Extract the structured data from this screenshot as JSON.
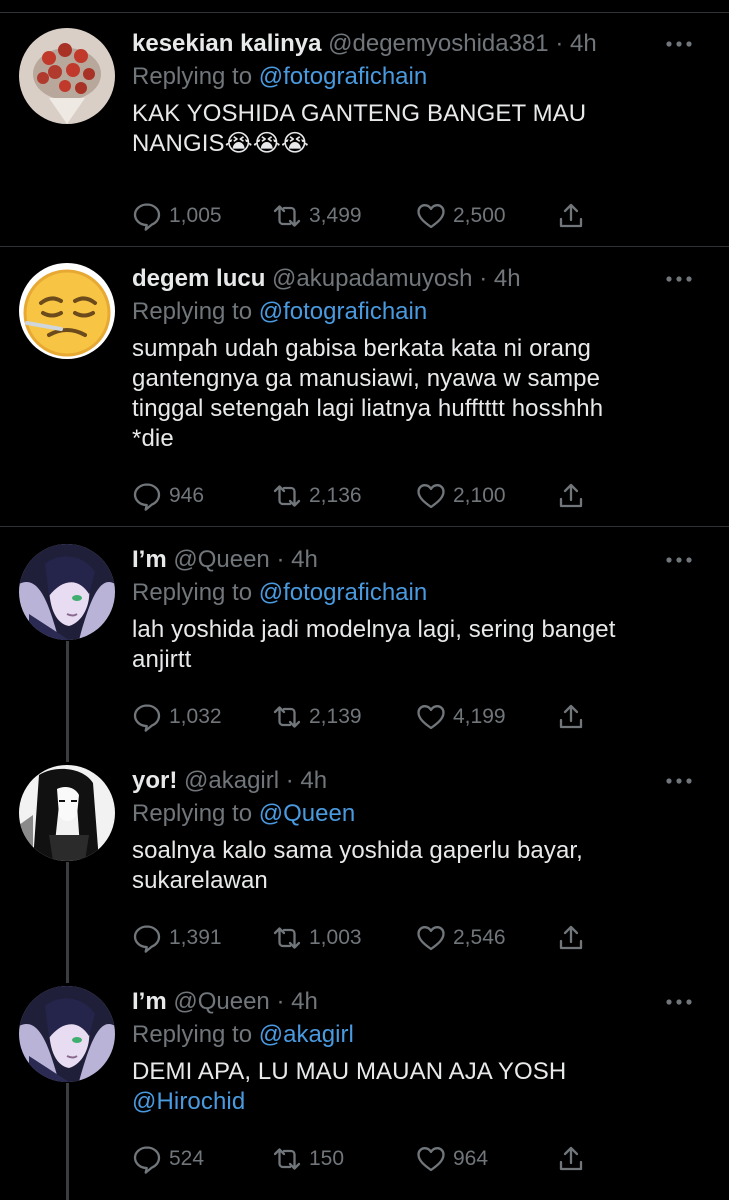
{
  "tweets": [
    {
      "name": "kesekian kalinya",
      "handle": "@degemyoshida381",
      "time": "4h",
      "replying_label": "Replying to",
      "replying_to": "@fotografichain",
      "lines": [
        "KAK YOSHIDA GANTENG BANGET MAU",
        "NANGIS😭😭😭"
      ],
      "mention_line": "",
      "replies": "1,005",
      "retweets": "3,499",
      "likes": "2,500"
    },
    {
      "name": "degem lucu",
      "handle": "@akupadamuyosh",
      "time": "4h",
      "replying_label": "Replying to",
      "replying_to": "@fotografichain",
      "lines": [
        "sumpah udah gabisa berkata kata ni orang",
        "gantengnya ga manusiawi, nyawa w sampe",
        "tinggal setengah lagi liatnya hufftttt hosshhh",
        "*die"
      ],
      "mention_line": "",
      "replies": "946",
      "retweets": "2,136",
      "likes": "2,100"
    },
    {
      "name": "I’m",
      "handle": "@Queen",
      "time": "4h",
      "replying_label": "Replying to",
      "replying_to": "@fotografichain",
      "lines": [
        "lah yoshida jadi modelnya lagi, sering banget",
        "anjirtt"
      ],
      "mention_line": "",
      "replies": "1,032",
      "retweets": "2,139",
      "likes": "4,199"
    },
    {
      "name": "yor!",
      "handle": "@akagirl",
      "time": "4h",
      "replying_label": "Replying to",
      "replying_to": "@Queen",
      "lines": [
        "soalnya kalo sama yoshida gaperlu bayar,",
        "sukarelawan"
      ],
      "mention_line": "",
      "replies": "1,391",
      "retweets": "1,003",
      "likes": "2,546"
    },
    {
      "name": "I’m",
      "handle": "@Queen",
      "time": "4h",
      "replying_label": "Replying to",
      "replying_to": "@akagirl",
      "lines": [
        "DEMI APA, LU MAU MAUAN AJA YOSH"
      ],
      "mention_line": "@Hirochid",
      "replies": "524",
      "retweets": "150",
      "likes": "964"
    }
  ],
  "colors": {
    "background": "#000000",
    "text": "#e7e9ea",
    "muted": "#71767b",
    "link": "#4a9ae0",
    "divider": "#2f3336"
  },
  "icons": {
    "reply": "comment-icon",
    "retweet": "retweet-icon",
    "like": "heart-icon",
    "share": "share-icon",
    "more": "more-dots-icon"
  }
}
